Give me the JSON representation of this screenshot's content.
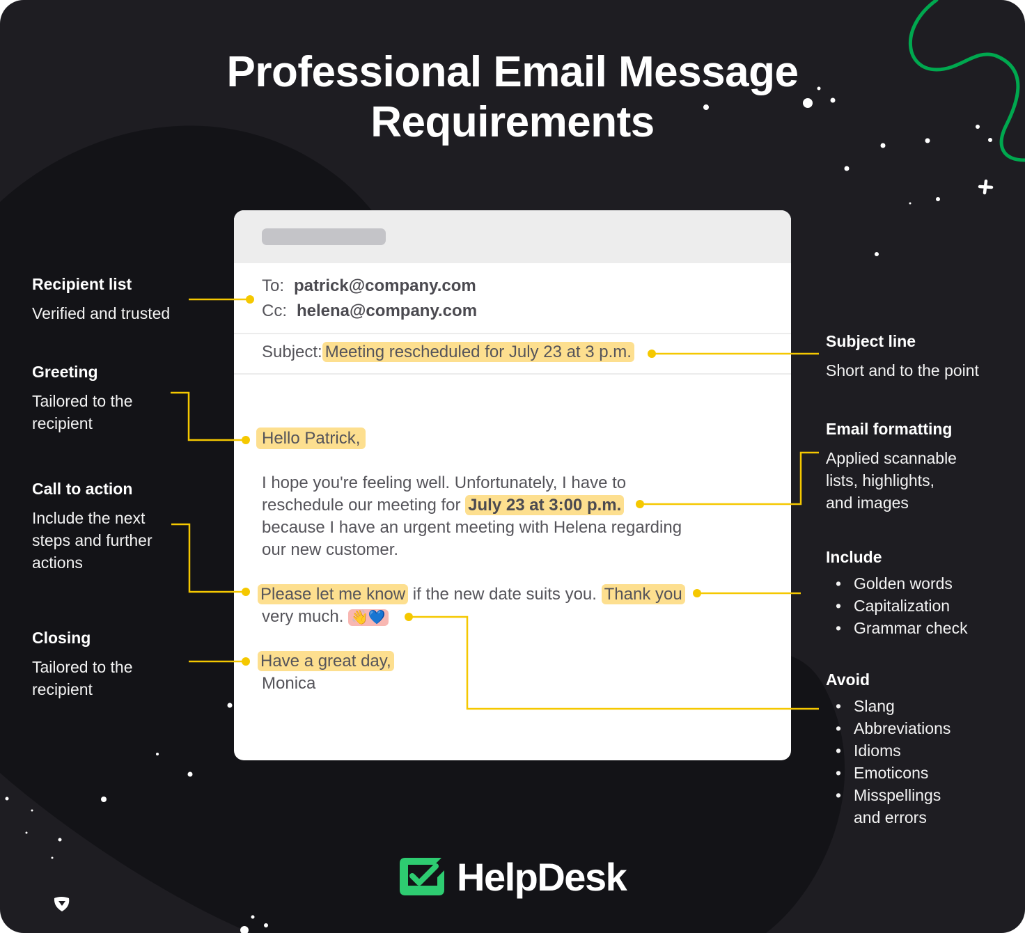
{
  "title": {
    "line1": "Professional Email Message",
    "line2": "Requirements"
  },
  "colors": {
    "background": "#1e1d22",
    "background_dark": "#131317",
    "accent_yellow": "#f5c800",
    "highlight": "#fddf8f",
    "emoji_highlight": "#f8b7b2",
    "brand_green": "#2ecc71",
    "decor_green": "#00a84f"
  },
  "annotations_left": [
    {
      "heading": "Recipient list",
      "text": [
        "Verified and trusted"
      ]
    },
    {
      "heading": "Greeting",
      "text": [
        "Tailored to the",
        "recipient"
      ]
    },
    {
      "heading": "Call to action",
      "text": [
        "Include the next",
        "steps and further",
        "actions"
      ]
    },
    {
      "heading": "Closing",
      "text": [
        "Tailored to the",
        "recipient"
      ]
    }
  ],
  "annotations_right": [
    {
      "heading": "Subject line",
      "text": [
        "Short and to the point"
      ]
    },
    {
      "heading": "Email formatting",
      "text": [
        "Applied scannable",
        "lists, highlights,",
        "and images"
      ]
    },
    {
      "heading": "Include",
      "items": [
        "Golden words",
        "Capitalization",
        "Grammar check"
      ]
    },
    {
      "heading": "Avoid",
      "items": [
        "Slang",
        "Abbreviations",
        "Idioms",
        "Emoticons",
        "Misspellings",
        "and errors"
      ]
    }
  ],
  "email": {
    "to_label": "To:",
    "to_value": "patrick@company.com",
    "cc_label": "Cc:",
    "cc_value": "helena@company.com",
    "subject_label": "Subject:",
    "subject_value": "Meeting rescheduled for July 23 at 3 p.m.",
    "greeting": "Hello Patrick,",
    "para1_line1": "I hope you're feeling well. Unfortunately, I have to",
    "para1_line2_pre": "reschedule our meeting for ",
    "para1_line2_date": "July 23 at 3:00 p.m.",
    "para1_line3": "because I have an urgent meeting with Helena regarding",
    "para1_line4": "our new customer.",
    "cta": "Please let me know",
    "cta_rest": " if the new date suits you. ",
    "thanks": "Thank you",
    "thanks_rest": "very much. ",
    "emoji": "👋💙",
    "closing": "Have a great day,",
    "signature": "Monica"
  },
  "logo": {
    "name": "HelpDesk",
    "icon": "checkmark-box-icon"
  }
}
